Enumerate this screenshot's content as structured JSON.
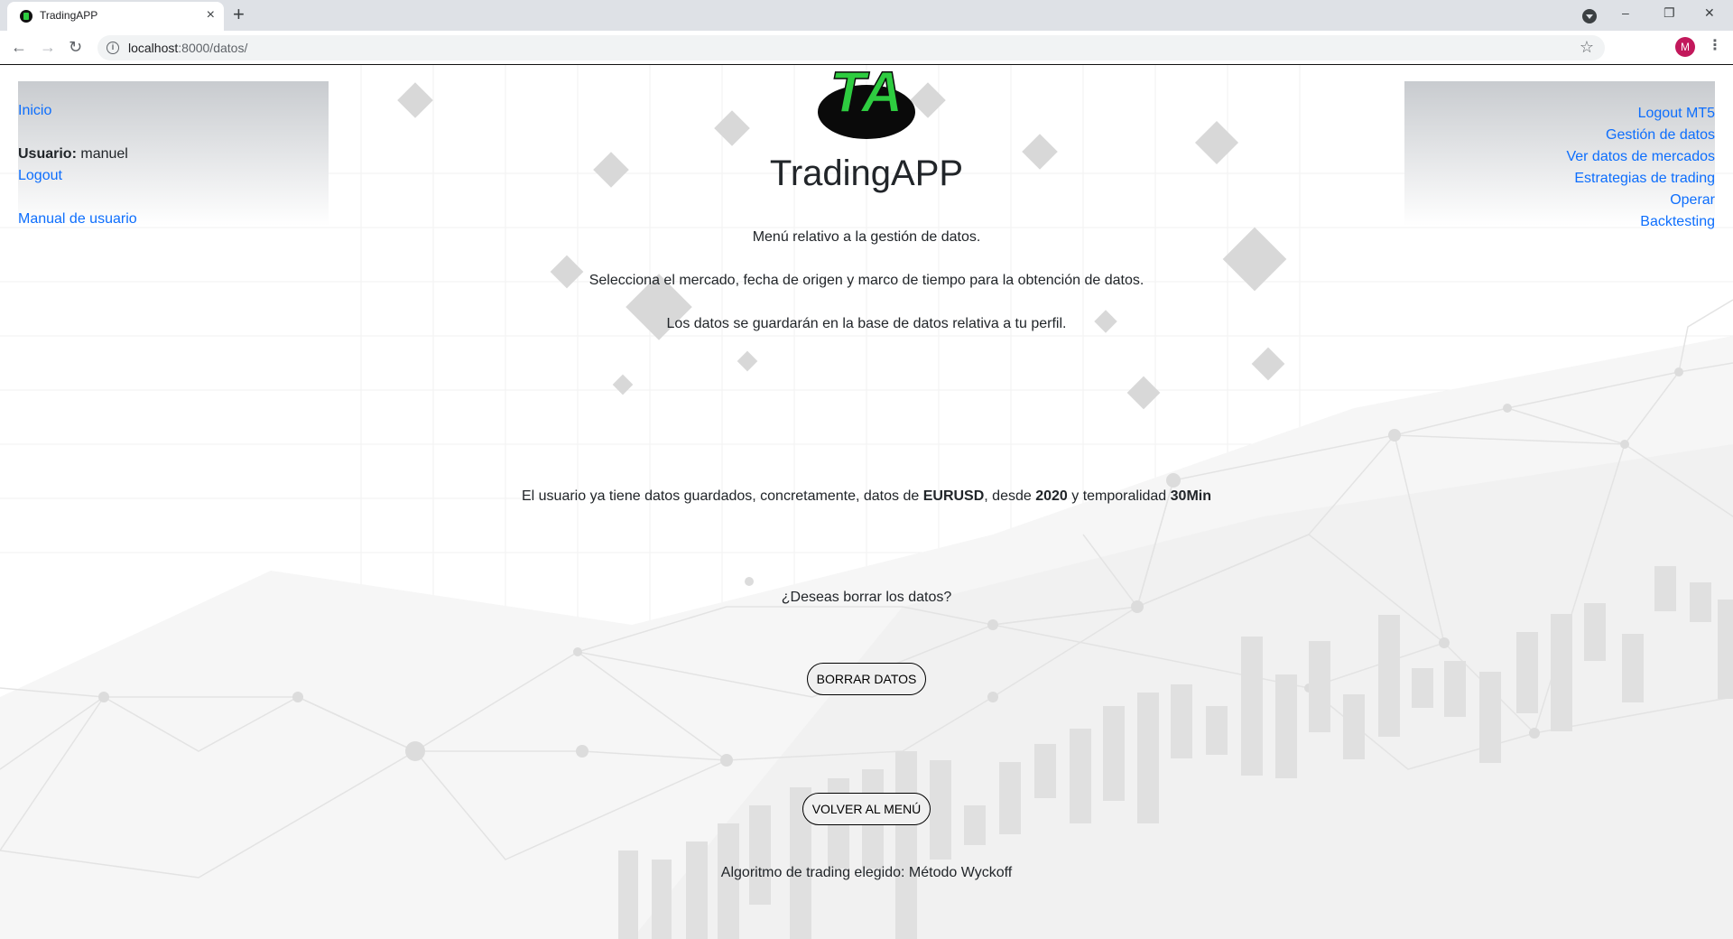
{
  "browser": {
    "tab_title": "TradingAPP",
    "tab_close": "×",
    "new_tab": "+",
    "url_host": "localhost",
    "url_path": ":8000/datos/",
    "avatar_letter": "M",
    "window_controls": {
      "minimize": "–",
      "restore": "❐",
      "close": "✕"
    }
  },
  "left_nav": {
    "home": "Inicio",
    "user_label": "Usuario:",
    "user_name": "manuel",
    "logout": "Logout",
    "manual": "Manual de usuario"
  },
  "right_nav": {
    "items": [
      "Logout MT5",
      "Gestión de datos",
      "Ver datos de mercados",
      "Estrategias de trading",
      "Operar",
      "Backtesting"
    ]
  },
  "logo_text": "TA",
  "title": "TradingAPP",
  "intro": {
    "line1": "Menú relativo a la gestión de datos.",
    "line2": "Selecciona el mercado, fecha de origen y marco de tiempo para la obtención de datos.",
    "line3": "Los datos se guardarán en la base de datos relativa a tu perfil."
  },
  "status": {
    "prefix": "El usuario ya tiene datos guardados, concretamente, datos de ",
    "market": "EURUSD",
    "mid1": ", desde ",
    "year": "2020",
    "mid2": " y temporalidad ",
    "timeframe": "30Min"
  },
  "question": "¿Deseas borrar los datos?",
  "buttons": {
    "delete": "BORRAR DATOS",
    "back": "VOLVER AL MENÚ"
  },
  "algorithm": "Algoritmo de trading elegido: Método Wyckoff",
  "colors": {
    "link": "#0d6efd",
    "logo_green": "#2ecc40",
    "text": "#212529"
  }
}
